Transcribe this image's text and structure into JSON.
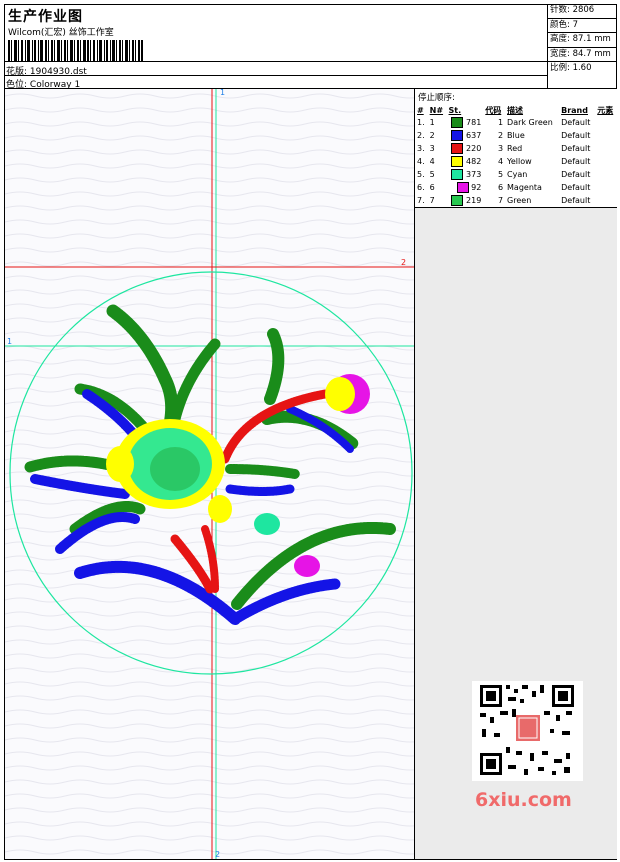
{
  "header": {
    "title": "生产作业图",
    "company": "Wilcom(汇宏) 丝饰工作室",
    "design_label": "花版:",
    "design_value": "1904930.dst",
    "colorway_label": "色位:",
    "colorway_value": "Colorway 1"
  },
  "stats": {
    "stitches": "针数: 2806",
    "colors": "颜色: 7",
    "height": "高度: 87.1 mm",
    "width": "宽度: 84.7 mm",
    "scale": "比例: 1.60"
  },
  "legend": {
    "title": "停止顺序:",
    "columns": [
      "#",
      "N#",
      "St.",
      "代码",
      "描述",
      "Brand",
      "元素"
    ],
    "rows": [
      {
        "num": "1.",
        "n": "1",
        "st": "781",
        "code": "1",
        "desc": "Dark Green",
        "brand": "Default",
        "color": "#1a8c1a"
      },
      {
        "num": "2.",
        "n": "2",
        "st": "637",
        "code": "2",
        "desc": "Blue",
        "brand": "Default",
        "color": "#1414e6"
      },
      {
        "num": "3.",
        "n": "3",
        "st": "220",
        "code": "3",
        "desc": "Red",
        "brand": "Default",
        "color": "#e61414"
      },
      {
        "num": "4.",
        "n": "4",
        "st": "482",
        "code": "4",
        "desc": "Yellow",
        "brand": "Default",
        "color": "#ffff00"
      },
      {
        "num": "5.",
        "n": "5",
        "st": "373",
        "code": "5",
        "desc": "Cyan",
        "brand": "Default",
        "color": "#1ee6a0"
      },
      {
        "num": "6.",
        "n": "6",
        "st": "92",
        "code": "6",
        "desc": "Magenta",
        "brand": "Default",
        "color": "#e614e6"
      },
      {
        "num": "7.",
        "n": "7",
        "st": "219",
        "code": "7",
        "desc": "Green",
        "brand": "Default",
        "color": "#28c850"
      }
    ]
  },
  "guides": {
    "v1": "1",
    "v2": "2",
    "h1": "1",
    "h2": "2"
  },
  "watermark": "6xiu.com"
}
